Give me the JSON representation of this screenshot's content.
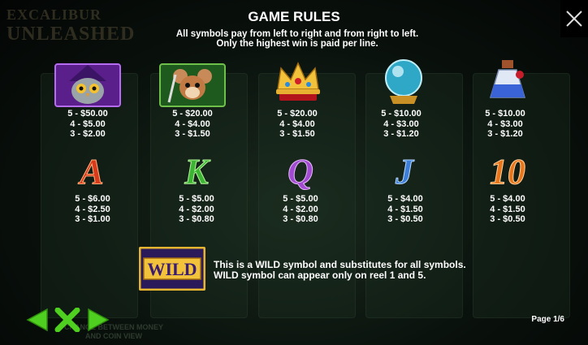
{
  "background": {
    "logo_line1": "EXCALIBUR",
    "logo_line2": "UNLEASHED",
    "bottom_hint": "CHANGE BETWEEN MONEY AND COIN VIEW"
  },
  "header": {
    "title": "GAME RULES",
    "subtitle_line1": "All symbols pay from left to right and from right to left.",
    "subtitle_line2": "Only the highest win is paid per line."
  },
  "paytable": [
    {
      "symbol": "owl-wizard",
      "pays": [
        "5 - $50.00",
        "4 - $5.00",
        "3 - $2.00"
      ]
    },
    {
      "symbol": "mouse-hero",
      "pays": [
        "5 - $20.00",
        "4 - $4.00",
        "3 - $1.50"
      ]
    },
    {
      "symbol": "crown",
      "pays": [
        "5 - $20.00",
        "4 - $4.00",
        "3 - $1.50"
      ]
    },
    {
      "symbol": "crystal-ball",
      "pays": [
        "5 - $10.00",
        "4 - $3.00",
        "3 - $1.20"
      ]
    },
    {
      "symbol": "potion",
      "pays": [
        "5 - $10.00",
        "4 - $3.00",
        "3 - $1.20"
      ]
    },
    {
      "symbol": "A",
      "pays": [
        "5 - $6.00",
        "4 - $2.50",
        "3 - $1.00"
      ]
    },
    {
      "symbol": "K",
      "pays": [
        "5 - $5.00",
        "4 - $2.00",
        "3 - $0.80"
      ]
    },
    {
      "symbol": "Q",
      "pays": [
        "5 - $5.00",
        "4 - $2.00",
        "3 - $0.80"
      ]
    },
    {
      "symbol": "J",
      "pays": [
        "5 - $4.00",
        "4 - $1.50",
        "3 - $0.50"
      ]
    },
    {
      "symbol": "10",
      "pays": [
        "5 - $4.00",
        "4 - $1.50",
        "3 - $0.50"
      ]
    }
  ],
  "wild": {
    "label": "WILD",
    "line1": "This is a WILD symbol and substitutes for all symbols.",
    "line2": "WILD symbol can appear only on reel 1 and 5."
  },
  "footer": {
    "page_label": "Page 1/6"
  },
  "colors": {
    "nav_green": "#4fcf1f",
    "wild_gold": "#e6b530",
    "letter_A": "#d83a1c",
    "letter_K": "#3bb533",
    "letter_Q": "#a34bd0",
    "letter_J": "#3d7fd8",
    "letter_10": "#e8761c"
  }
}
